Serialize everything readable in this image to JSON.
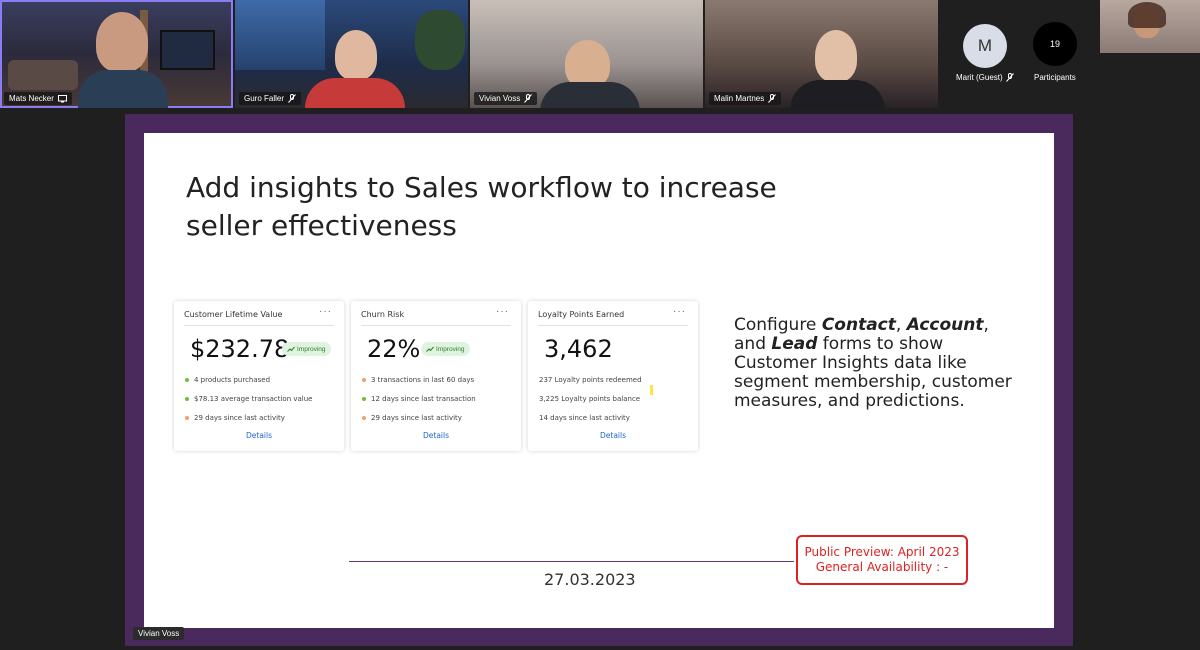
{
  "participants": [
    {
      "name": "Mats Necker",
      "muted": false
    },
    {
      "name": "Guro Faller",
      "muted": true
    },
    {
      "name": "Vivian Voss",
      "muted": true
    },
    {
      "name": "Malin Martnes",
      "muted": true
    }
  ],
  "roster": {
    "guest": {
      "initial": "M",
      "name": "Marit (Guest)"
    },
    "participants": {
      "count": "19",
      "label": "Participants"
    }
  },
  "slide": {
    "title": "Add insights to Sales workflow to increase seller effectiveness",
    "cards": [
      {
        "title": "Customer Lifetime Value",
        "more": "···",
        "value": "$232.78",
        "badge": "Improving",
        "items": [
          {
            "text": "4 products purchased",
            "color": "#6bbf3a"
          },
          {
            "text": "$78.13 average transaction value",
            "color": "#6bbf3a"
          },
          {
            "text": "29 days since last activity",
            "color": "#f0a070"
          }
        ],
        "details": "Details"
      },
      {
        "title": "Churn Risk",
        "more": "···",
        "value": "22%",
        "badge": "Improving",
        "items": [
          {
            "text": "3 transactions in last 60 days",
            "color": "#f0a070"
          },
          {
            "text": "12 days since last transaction",
            "color": "#6bbf3a"
          },
          {
            "text": "29 days since last activity",
            "color": "#f0a070"
          }
        ],
        "details": "Details"
      },
      {
        "title": "Loyalty Points Earned",
        "more": "···",
        "value": "3,462",
        "items": [
          {
            "text": "237 Loyalty points redeemed"
          },
          {
            "text": "3,225 Loyalty points balance"
          },
          {
            "text": "14 days since last activity"
          }
        ],
        "details": "Details"
      }
    ],
    "description": {
      "part1": "Configure ",
      "contact": "Contact",
      "comma": ", ",
      "account": "Account",
      "part2": ",",
      "part3": "and ",
      "lead": "Lead",
      "part4": " forms to show Customer Insights data like segment membership, customer measures, and predictions."
    },
    "date": "27.03.2023",
    "preview": {
      "line1": "Public Preview: April 2023",
      "line2": "General Availability : -"
    }
  },
  "presenter_tag": "Vivian Voss",
  "colors": {
    "frame": "#4a2a5c",
    "active_speaker": "#8b7cf6",
    "preview_red": "#d22222"
  }
}
